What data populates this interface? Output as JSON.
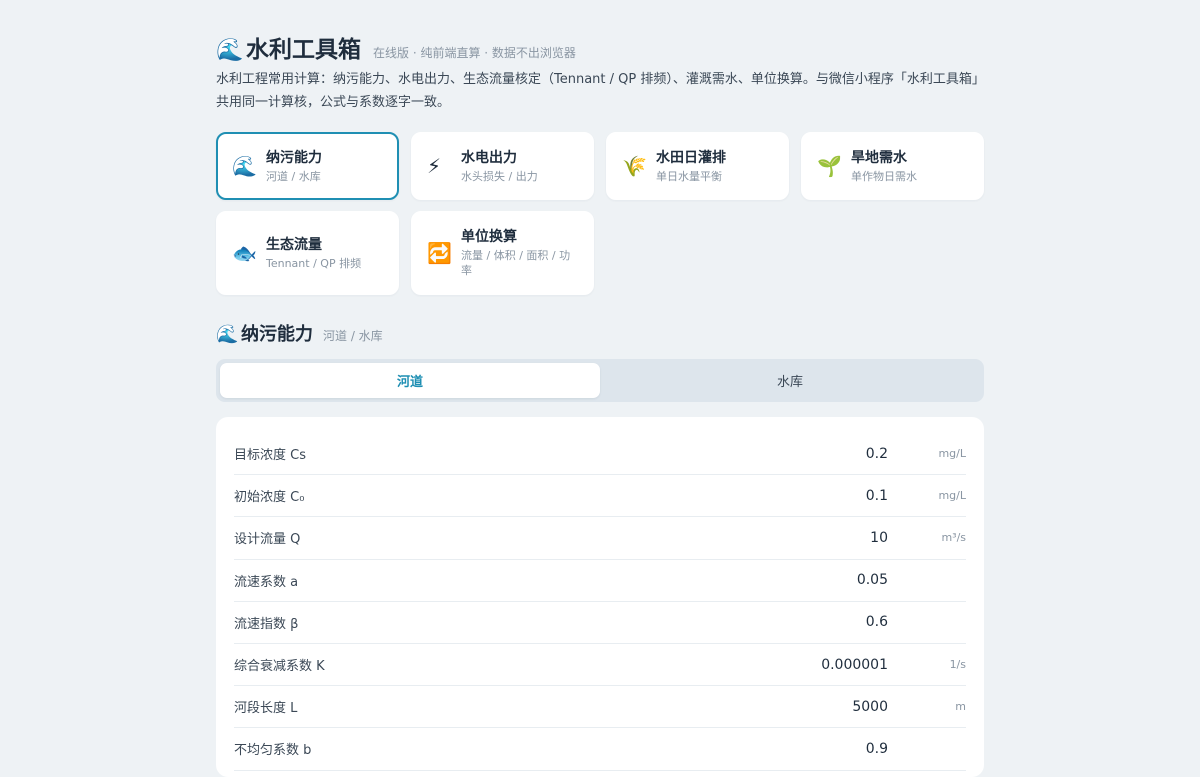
{
  "header": {
    "logo_icon": "🌊",
    "title": "水利工具箱",
    "subtitle": "在线版 · 纯前端直算 · 数据不出浏览器",
    "description": "水利工程常用计算：纳污能力、水电出力、生态流量核定（Tennant / QP 排频）、灌溉需水、单位换算。与微信小程序「水利工具箱」共用同一计算核，公式与系数逐字一致。"
  },
  "tools": [
    {
      "icon": "🌊",
      "title": "纳污能力",
      "subtitle": "河道 / 水库",
      "active": true
    },
    {
      "icon": "⚡",
      "title": "水电出力",
      "subtitle": "水头损失 / 出力",
      "active": false
    },
    {
      "icon": "🌾",
      "title": "水田日灌排",
      "subtitle": "单日水量平衡",
      "active": false
    },
    {
      "icon": "🌱",
      "title": "旱地需水",
      "subtitle": "单作物日需水",
      "active": false
    },
    {
      "icon": "🐟",
      "title": "生态流量",
      "subtitle": "Tennant / QP 排频",
      "active": false
    },
    {
      "icon": "🔁",
      "title": "单位换算",
      "subtitle": "流量 / 体积 / 面积 / 功率",
      "active": false
    }
  ],
  "section": {
    "icon": "🌊",
    "title": "纳污能力",
    "subtitle": "河道 / 水库"
  },
  "segments": [
    {
      "label": "河道",
      "active": true
    },
    {
      "label": "水库",
      "active": false
    }
  ],
  "form": {
    "rows": [
      {
        "label": "目标浓度 Cs",
        "value": "0.2",
        "unit": "mg/L"
      },
      {
        "label": "初始浓度 C₀",
        "value": "0.1",
        "unit": "mg/L"
      },
      {
        "label": "设计流量 Q",
        "value": "10",
        "unit": "m³/s"
      },
      {
        "label": "流速系数 a",
        "value": "0.05",
        "unit": ""
      },
      {
        "label": "流速指数 β",
        "value": "0.6",
        "unit": ""
      },
      {
        "label": "综合衰减系数 K",
        "value": "0.000001",
        "unit": "1/s"
      },
      {
        "label": "河段长度 L",
        "value": "5000",
        "unit": "m"
      },
      {
        "label": "不均匀系数 b",
        "value": "0.9",
        "unit": ""
      }
    ]
  }
}
